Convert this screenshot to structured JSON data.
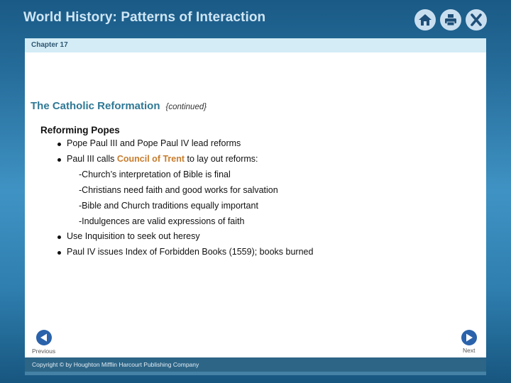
{
  "app": {
    "title": "World History: Patterns of Interaction"
  },
  "toolbar": {
    "icons": [
      {
        "name": "home-icon",
        "label": "Home"
      },
      {
        "name": "print-icon",
        "label": "Print"
      },
      {
        "name": "close-icon",
        "label": "X"
      }
    ]
  },
  "slide": {
    "chapter": "Chapter 17",
    "heading": "The Catholic Reformation",
    "heading_suffix": "{continued}",
    "subheading": "Reforming Popes",
    "lines": [
      {
        "type": "bullet",
        "text": "Pope Paul III and Pope Paul IV lead reforms"
      },
      {
        "type": "bullet",
        "pre": "Paul III calls ",
        "highlight": "Council of Trent",
        "post": " to lay out reforms:"
      },
      {
        "type": "sub",
        "text": "-Church’s interpretation of Bible is final"
      },
      {
        "type": "sub",
        "text": "-Christians need faith and good works for salvation"
      },
      {
        "type": "sub",
        "text": "-Bible and Church traditions equally important"
      },
      {
        "type": "sub",
        "text": "-Indulgences are valid expressions of faith"
      },
      {
        "type": "bullet",
        "text": "Use Inquisition to seek out heresy"
      },
      {
        "type": "bullet",
        "text": "Paul IV issues Index of Forbidden Books (1559); books burned"
      }
    ],
    "highlight_color": "#c87c2c"
  },
  "nav": {
    "previous_label": "Previous",
    "next_label": "Next"
  },
  "footer": {
    "copyright": "Copyright © by Houghton Mifflin Harcourt Publishing Company"
  }
}
